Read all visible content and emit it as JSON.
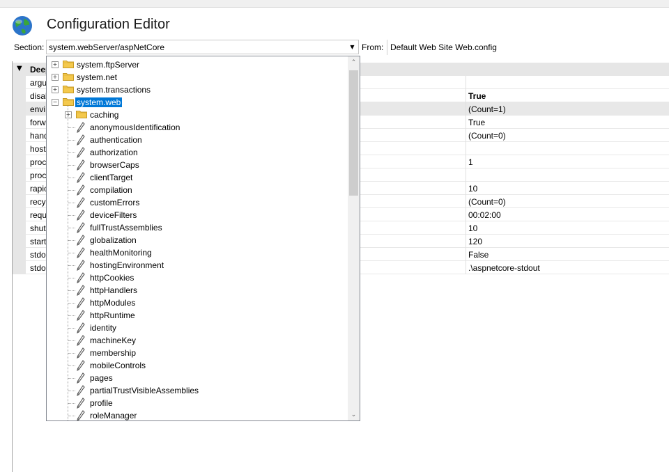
{
  "title": "Configuration Editor",
  "section": {
    "label": "Section:",
    "value": "system.webServer/aspNetCore"
  },
  "from": {
    "label": "From:",
    "value": "Default Web Site Web.config"
  },
  "grid": {
    "group": "Deep",
    "rows": [
      {
        "name": "argu",
        "value": ""
      },
      {
        "name": "disal",
        "value": "True"
      },
      {
        "name": "envi",
        "value": "(Count=1)"
      },
      {
        "name": "forw",
        "value": "True"
      },
      {
        "name": "hand",
        "value": "(Count=0)"
      },
      {
        "name": "host",
        "value": ""
      },
      {
        "name": "proc",
        "value": "1"
      },
      {
        "name": "proc",
        "value": ""
      },
      {
        "name": "rapic",
        "value": "10"
      },
      {
        "name": "recy",
        "value": "(Count=0)"
      },
      {
        "name": "requ",
        "value": "00:02:00"
      },
      {
        "name": "shut",
        "value": "10"
      },
      {
        "name": "start",
        "value": "120"
      },
      {
        "name": "stdo",
        "value": "False"
      },
      {
        "name": "stdo",
        "value": ".\\aspnetcore-stdout"
      }
    ]
  },
  "tree": {
    "folders": [
      {
        "label": "system.ftpServer"
      },
      {
        "label": "system.net"
      },
      {
        "label": "system.transactions"
      },
      {
        "label": "system.web"
      }
    ],
    "subfolder": {
      "label": "caching"
    },
    "leaves": [
      "anonymousIdentification",
      "authentication",
      "authorization",
      "browserCaps",
      "clientTarget",
      "compilation",
      "customErrors",
      "deviceFilters",
      "fullTrustAssemblies",
      "globalization",
      "healthMonitoring",
      "hostingEnvironment",
      "httpCookies",
      "httpHandlers",
      "httpModules",
      "httpRuntime",
      "identity",
      "machineKey",
      "membership",
      "mobileControls",
      "pages",
      "partialTrustVisibleAssemblies",
      "profile",
      "roleManager"
    ]
  },
  "colors": {
    "selection": "#0078d7",
    "folder": "#f4c94d"
  },
  "icons": {
    "app": "globe-icon",
    "folder": "folder-icon",
    "leaf": "pencil-icon"
  }
}
